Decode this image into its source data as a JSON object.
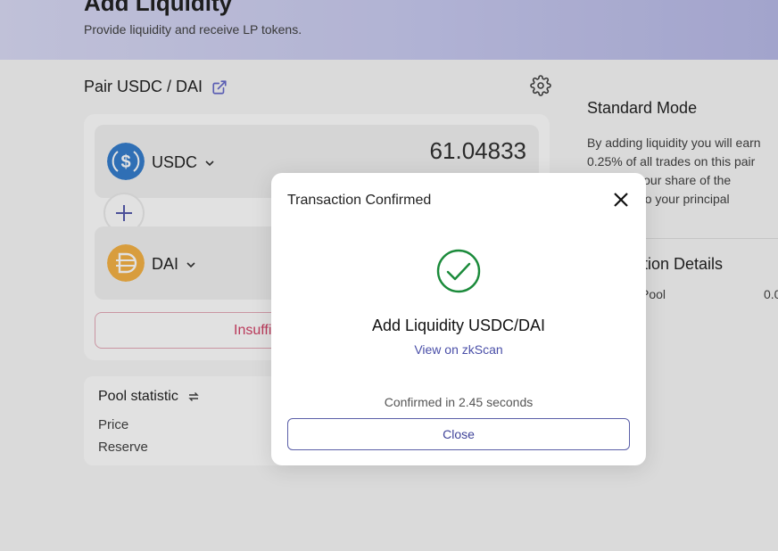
{
  "header": {
    "title": "Add Liquidity",
    "subtitle": "Provide liquidity and receive LP tokens."
  },
  "pair": {
    "title": "Pair USDC / DAI",
    "external_icon": "external-link-icon",
    "settings_icon": "gear-icon"
  },
  "tokens": [
    {
      "symbol": "USDC",
      "amount": "61.04833",
      "icon": "usdc-coin-icon",
      "color": "#2775ca"
    },
    {
      "symbol": "DAI",
      "amount": "",
      "icon": "dai-coin-icon",
      "color": "#f5ac37"
    }
  ],
  "action_button": {
    "label": "Insuffi"
  },
  "pool_statistic": {
    "title": "Pool statistic",
    "rows": [
      "Price",
      "Reserve"
    ]
  },
  "right_panel": {
    "title": "Standard Mode",
    "text_lines": [
      "By adding liquidity you will earn",
      "0.25% of all trades on this pair",
      "nal to your share of the",
      "added to your principal"
    ],
    "details_title": "ction Details",
    "row_label": "Pool",
    "row_value": "0.0"
  },
  "modal": {
    "title": "Transaction Confirmed",
    "heading": "Add Liquidity USDC/DAI",
    "link": "View on zkScan",
    "confirmed_text": "Confirmed in 2.45 seconds",
    "button_label": "Close",
    "accent_color": "#1a8a3a"
  }
}
